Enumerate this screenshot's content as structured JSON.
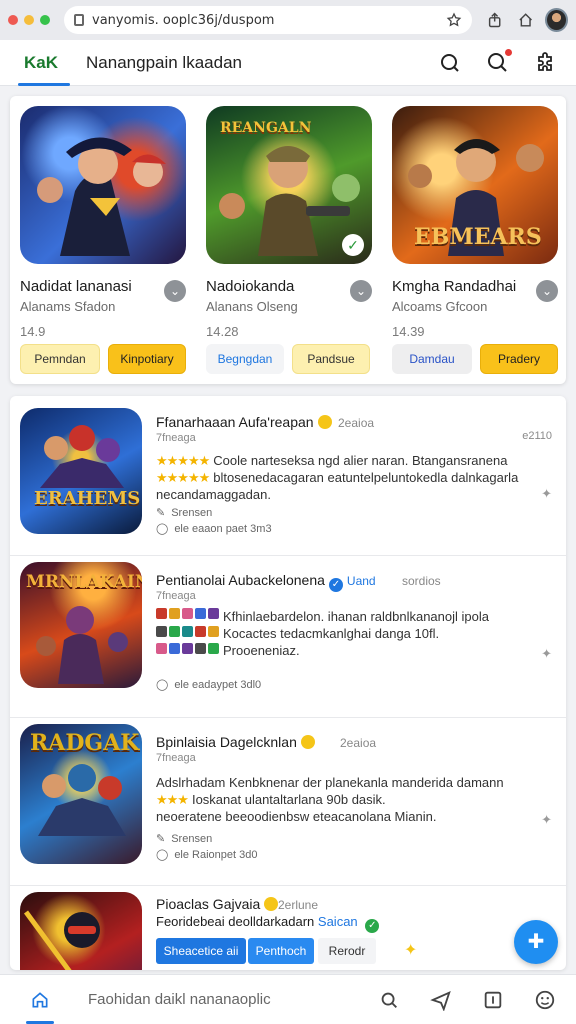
{
  "browser": {
    "url": "vanyomis. ooplc36j/duspom",
    "dot_colors": [
      "#ee5a52",
      "#f5bd3b",
      "#36c24b"
    ]
  },
  "header": {
    "brand": "KaK",
    "title": "Nanangpain lkaadan"
  },
  "featured": [
    {
      "name": "Nadidat lananasi",
      "subtitle": "Alanams Sfadon",
      "size": "14.9",
      "buttons": [
        "Pemndan",
        "Kinpotiary"
      ],
      "palette": [
        "#1b2b6e",
        "#3a6fd8",
        "#e04a2a"
      ]
    },
    {
      "name": "Nadoiokanda",
      "subtitle": "Alanans Olseng",
      "size": "14.28",
      "art_text": "REANGALN",
      "buttons": [
        "Begngdan",
        "Pandsue"
      ],
      "palette": [
        "#0f3a22",
        "#4f9a2b",
        "#c9a23a"
      ]
    },
    {
      "name": "Kmgha Randadhai",
      "subtitle": "Alcoams Gfcoon",
      "size": "14.39",
      "art_text": "EBMEARS",
      "buttons": [
        "Damdau",
        "Pradery"
      ],
      "palette": [
        "#3a1c0e",
        "#e26a1a",
        "#f6c25a"
      ]
    }
  ],
  "list": [
    {
      "title": "Ffanarhaaan Aufa'reapan",
      "tag": "2eaioa",
      "developer": "7fneaga",
      "number": "e2110",
      "art_text": "ERAHEMS",
      "desc_lines": [
        "Coole narteseksa ngd alier naran. Btangansranena",
        "bltosenedacagaran eatuntelpeluntokedla dalnkagarla",
        "necandamaggadan."
      ],
      "meta1": "Srensen",
      "meta2": "ele eaaon paet 3m3",
      "palette": [
        "#0e2b6b",
        "#2f6fd6",
        "#d8a21a"
      ]
    },
    {
      "title": "Pentianolai Aubackelonena",
      "tag_verified": "Uand",
      "tag": "sordios",
      "developer": "7fneaga",
      "art_text": "MRNLAKAIN",
      "desc_lines": [
        "Kfhinlaebardelon. ihanan raldbnlkananojl ipola",
        "Kocactes tedacmkanlghai danga 10fl.",
        "Prooeneniaz."
      ],
      "meta2": "ele eadaypet 3dl0",
      "palette": [
        "#3a0f2a",
        "#d84a1a",
        "#f3b23a"
      ]
    },
    {
      "title": "Bpinlaisia Dagelcknlan",
      "tag": "2eaioa",
      "developer": "7fneaga",
      "art_text": "RADGAK",
      "desc_lines": [
        "Adslrhadam Kenbknenar der planekanla manderida damann",
        "Ioskanat ulantaltarlana 90b dasik.",
        "neoeratene beeoodienbsw eteacanolana Mianin."
      ],
      "meta1": "Srensen",
      "meta2": "ele Raionpet 3d0",
      "palette": [
        "#1a1f4a",
        "#2c7fcf",
        "#e1b21c"
      ]
    },
    {
      "title": "Pioaclas Gajvaia",
      "tag": "2erlune",
      "desc_line": "Feoridebeai deolldarkadarn",
      "desc_link": "Saican",
      "buttons": [
        "Sheacetice aii",
        "Penthoch",
        "Rerodr"
      ],
      "palette": [
        "#2a0e0e",
        "#b32020",
        "#f0c030"
      ]
    }
  ],
  "bottom_nav": {
    "text": "Faohidan daikl nananaoplic"
  }
}
